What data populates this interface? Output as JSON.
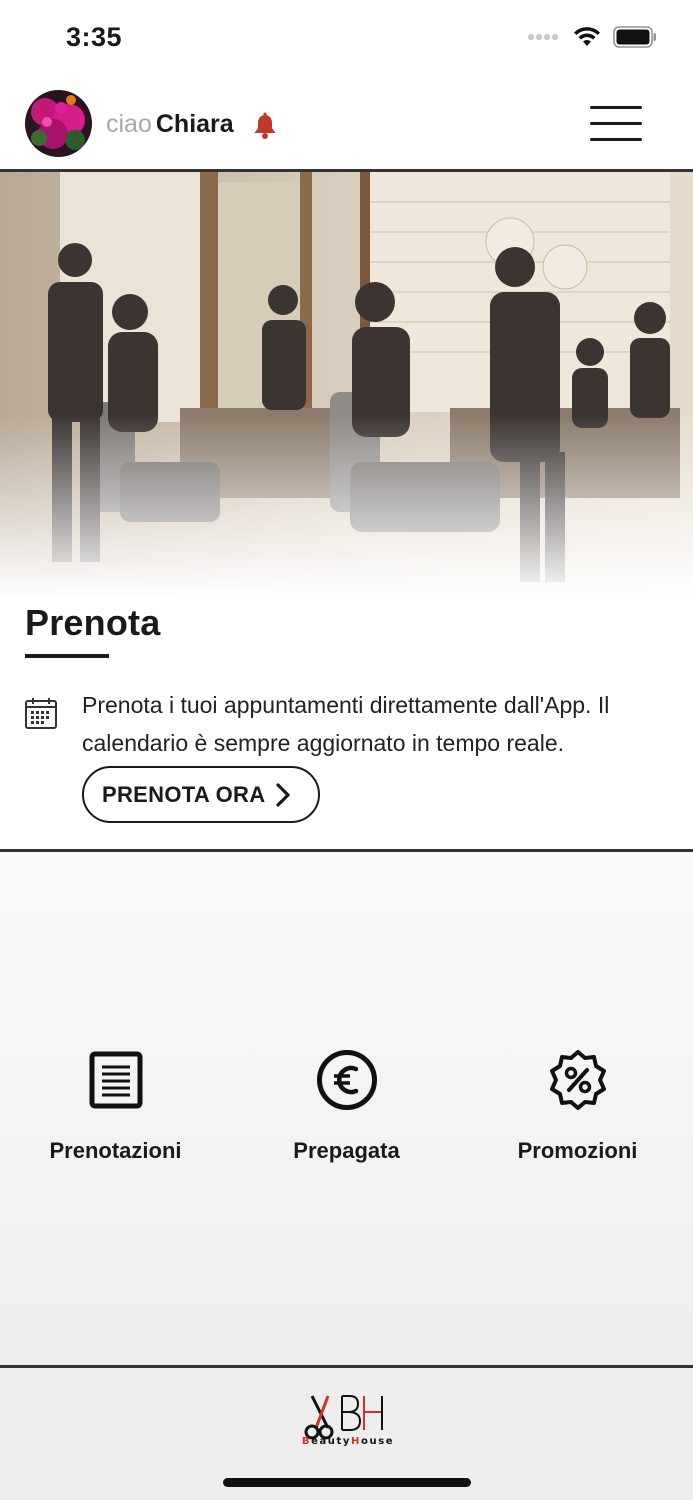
{
  "status": {
    "time": "3:35"
  },
  "header": {
    "greeting_prefix": "ciao",
    "user_name": "Chiara",
    "icons": [
      "avatar",
      "bell-icon",
      "menu-icon"
    ]
  },
  "booking": {
    "title": "Prenota",
    "description": "Prenota i tuoi appuntamenti direttamente dall'App. Il calendario è sempre aggiornato in tempo reale.",
    "cta_label": "PRENOTA ORA",
    "icon": "calendar-icon"
  },
  "shortcuts": [
    {
      "label": "Prenotazioni",
      "icon": "document-list-icon"
    },
    {
      "label": "Prepagata",
      "icon": "euro-icon"
    },
    {
      "label": "Promozioni",
      "icon": "percent-badge-icon"
    }
  ],
  "footer": {
    "logo_text": "BeautyHouse",
    "logo_initials": "BH"
  },
  "colors": {
    "accent": "#d0312d",
    "text": "#1a1a1a",
    "muted": "#a8a8a8"
  }
}
